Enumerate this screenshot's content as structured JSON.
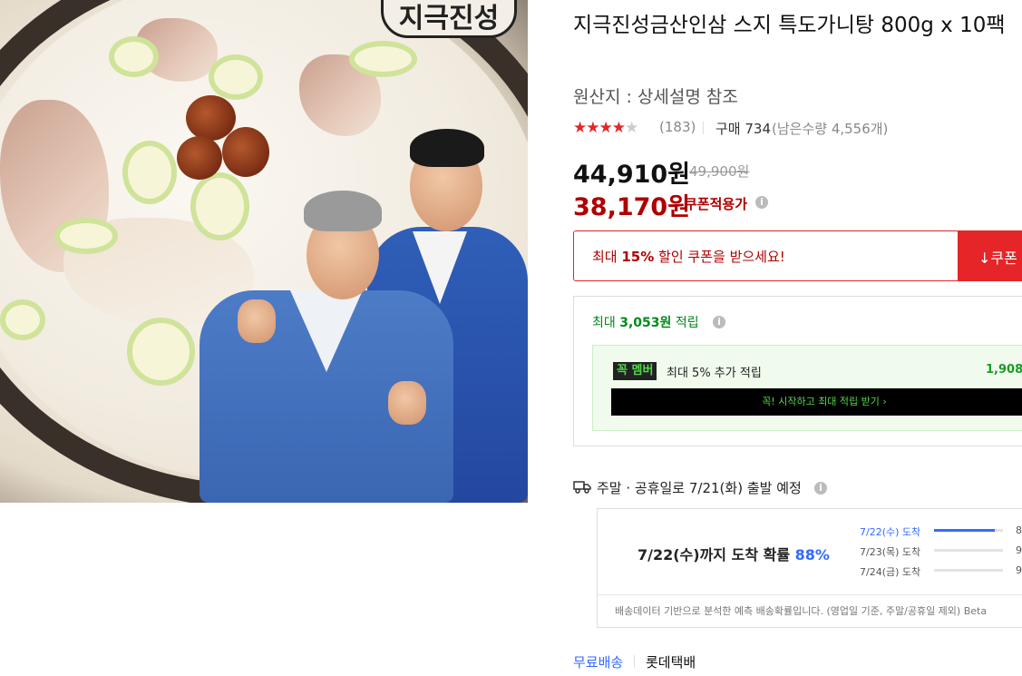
{
  "product": {
    "title": "지극진성금산인삼 스지 특도가니탕 800g x 10팩",
    "origin": "원산지 : 상세설명 참조",
    "image_logo_text": "지극진성"
  },
  "rating": {
    "stars": "★★★★★",
    "value": 4.5,
    "review_count": "(183)",
    "purchase": "구매 734",
    "stock": "(남은수량 4,556개)"
  },
  "price": {
    "sale": "44,910원",
    "original": "49,900원",
    "coupon_price": "38,170원",
    "coupon_label": "쿠폰적용가",
    "info_icon": "i"
  },
  "coupon": {
    "pre": "최대 ",
    "bold": "15%",
    "post": " 할인 쿠폰을 받으세요!",
    "button_label": "↓쿠폰"
  },
  "reward": {
    "pre": "최대 ",
    "amount": "3,053원",
    "post": " 적립",
    "wow_badge": "꼭 멤버",
    "wow_text": "최대 5% 추가 적립",
    "wow_amount": "1,908",
    "wow_cta": "꼭! 시작하고 최대 적립 받기 ›"
  },
  "shipping": {
    "note": "주말 · 공휴일로 7/21(화) 출발 예정",
    "prob_pre": "7/22(수)까지 도착 확률 ",
    "prob_pct": "88%",
    "rows": [
      {
        "label": "7/22(수) 도착",
        "fill": 0.88,
        "pct": "8"
      },
      {
        "label": "7/23(목) 도착",
        "fill": 0.0,
        "pct": "9"
      },
      {
        "label": "7/24(금) 도착",
        "fill": 0.0,
        "pct": "9"
      }
    ],
    "footnote": "배송데이터 기반으로 분석한 예측 배송확률입니다. (영업일 기준, 주말/공휴일 제외) Beta",
    "free": "무료배송",
    "carrier": "롯데택배"
  },
  "colors": {
    "accent_red": "#e52528",
    "price_red": "#ae0000",
    "blue": "#346aff",
    "green": "#00891a"
  }
}
